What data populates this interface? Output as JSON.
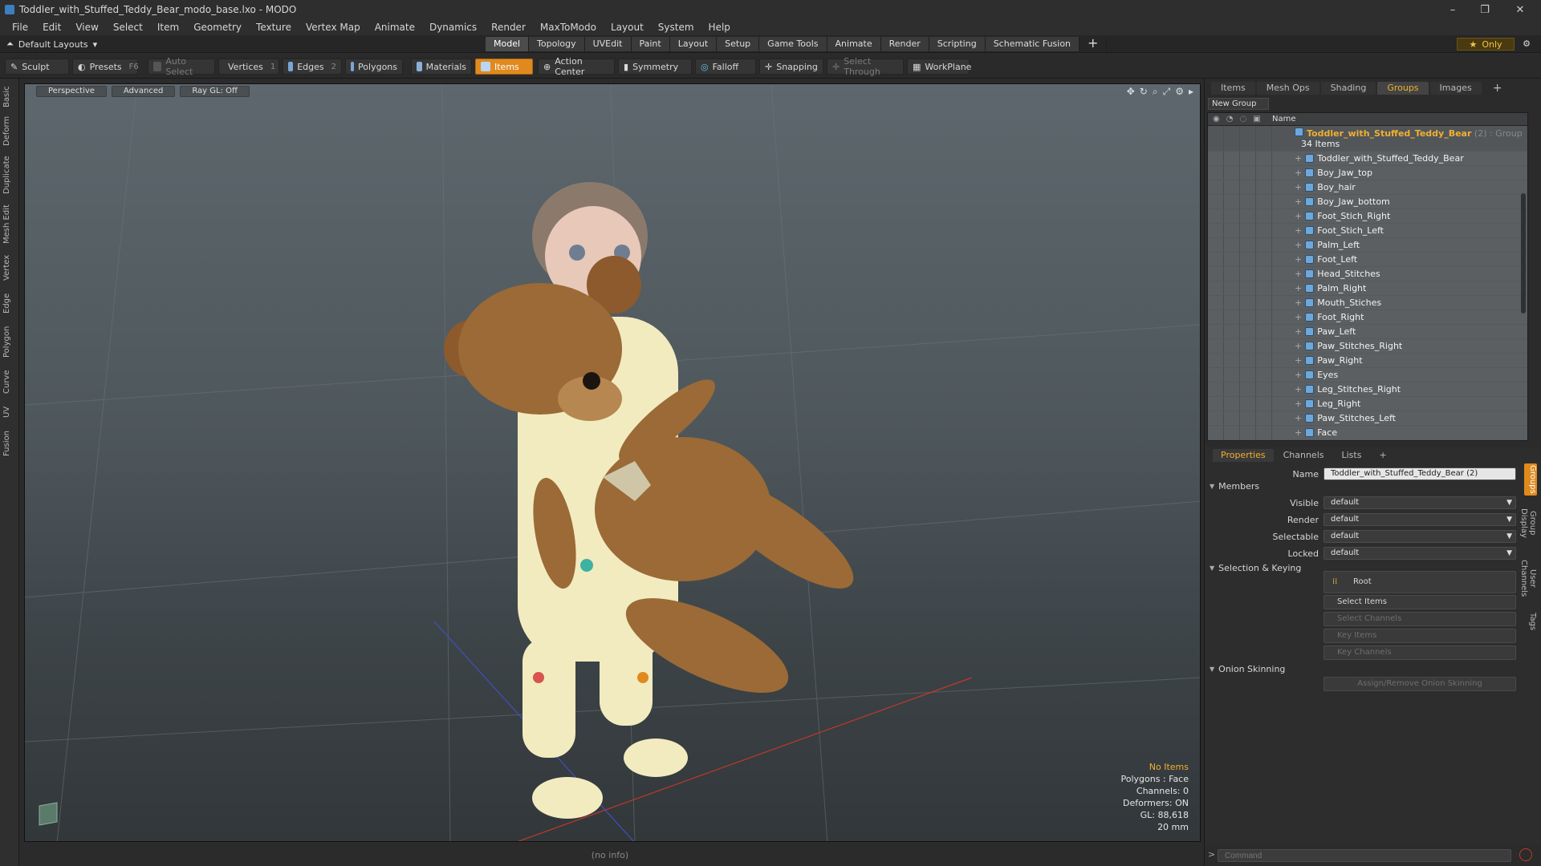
{
  "window": {
    "title": "Toddler_with_Stuffed_Teddy_Bear_modo_base.lxo - MODO",
    "minimize": "–",
    "restore": "❐",
    "close": "✕"
  },
  "menu": [
    "File",
    "Edit",
    "View",
    "Select",
    "Item",
    "Geometry",
    "Texture",
    "Vertex Map",
    "Animate",
    "Dynamics",
    "Render",
    "MaxToModo",
    "Layout",
    "System",
    "Help"
  ],
  "layout_bar": {
    "layout_name": "Default Layouts",
    "tabs": [
      "Model",
      "Topology",
      "UVEdit",
      "Paint",
      "Layout",
      "Setup",
      "Game Tools",
      "Animate",
      "Render",
      "Scripting",
      "Schematic Fusion"
    ],
    "active_tab": "Model",
    "plus": "+",
    "only_label": "Only"
  },
  "toolbar": {
    "sculpt": "Sculpt",
    "presets": "Presets",
    "presets_key": "F6",
    "auto_select": "Auto Select",
    "vertices": "Vertices",
    "vertices_count": "1",
    "edges": "Edges",
    "edges_count": "2",
    "polygons": "Polygons",
    "materials": "Materials",
    "items": "Items",
    "action_center": "Action Center",
    "symmetry": "Symmetry",
    "falloff": "Falloff",
    "snapping": "Snapping",
    "select_through": "Select Through",
    "workplane": "WorkPlane"
  },
  "left_strip": [
    "Basic",
    "Deform",
    "Duplicate",
    "Mesh Edit",
    "Vertex",
    "Edge",
    "Polygon",
    "Curve",
    "UV",
    "Fusion"
  ],
  "viewport": {
    "tabs": [
      "Perspective",
      "Advanced",
      "Ray GL: Off"
    ],
    "stats": {
      "no_items": "No Items",
      "polygons": "Polygons : Face",
      "channels": "Channels: 0",
      "deformers": "Deformers: ON",
      "gl": "GL: 88,618",
      "scale": "20 mm"
    }
  },
  "status": "(no info)",
  "right_panel": {
    "tabs": [
      "Items",
      "Mesh Ops",
      "Shading",
      "Groups",
      "Images"
    ],
    "active_tab": "Groups",
    "new_group": "New Group",
    "column_name": "Name",
    "group": {
      "name": "Toddler_with_Stuffed_Teddy_Bear",
      "suffix": "(2) : Group",
      "count": "34 Items"
    },
    "items": [
      "Toddler_with_Stuffed_Teddy_Bear",
      "Boy_Jaw_top",
      "Boy_hair",
      "Boy_Jaw_bottom",
      "Foot_Stich_Right",
      "Foot_Stich_Left",
      "Palm_Left",
      "Foot_Left",
      "Head_Stitches",
      "Palm_Right",
      "Mouth_Stiches",
      "Foot_Right",
      "Paw_Left",
      "Paw_Stitches_Right",
      "Paw_Right",
      "Eyes",
      "Leg_Stitches_Right",
      "Leg_Right",
      "Paw_Stitches_Left",
      "Face"
    ]
  },
  "properties": {
    "tabs": [
      "Properties",
      "Channels",
      "Lists"
    ],
    "active_tab": "Properties",
    "name_label": "Name",
    "name_value": "Toddler_with_Stuffed_Teddy_Bear (2)",
    "members": "Members",
    "visible_label": "Visible",
    "visible_value": "default",
    "render_label": "Render",
    "render_value": "default",
    "selectable_label": "Selectable",
    "selectable_value": "default",
    "locked_label": "Locked",
    "locked_value": "default",
    "selection_keying": "Selection & Keying",
    "root": "Root",
    "select_items": "Select Items",
    "select_channels": "Select Channels",
    "key_items": "Key Items",
    "key_channels": "Key Channels",
    "onion_skinning": "Onion Skinning",
    "assign_onion": "Assign/Remove Onion Skinning",
    "side_tabs": [
      "Groups",
      "Group Display",
      "User Channels",
      "Tags"
    ]
  },
  "command": {
    "placeholder": "Command",
    "prompt": ">"
  },
  "colors": {
    "accent": "#e08a1e",
    "highlight": "#f0b030"
  }
}
